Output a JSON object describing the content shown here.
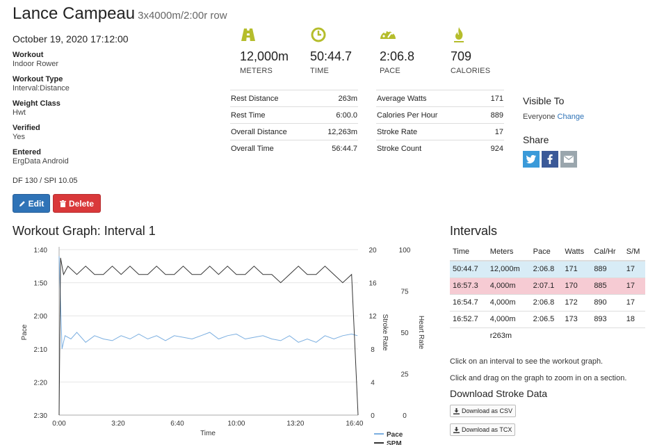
{
  "header": {
    "name": "Lance Campeau",
    "subtitle": "3x4000m/2:00r row",
    "date": "October 19, 2020 17:12:00"
  },
  "info": [
    {
      "label": "Workout",
      "value": "Indoor Rower"
    },
    {
      "label": "Workout Type",
      "value": "Interval:Distance"
    },
    {
      "label": "Weight Class",
      "value": "Hwt"
    },
    {
      "label": "Verified",
      "value": "Yes"
    },
    {
      "label": "Entered",
      "value": "ErgData Android"
    }
  ],
  "df_spi": "DF 130 / SPI 10.05",
  "buttons": {
    "edit": "Edit",
    "delete": "Delete"
  },
  "stats": [
    {
      "value": "12,000m",
      "unit": "METERS",
      "icon": "road-icon"
    },
    {
      "value": "50:44.7",
      "unit": "TIME",
      "icon": "clock-icon"
    },
    {
      "value": "2:06.8",
      "unit": "PACE",
      "icon": "dashboard-icon"
    },
    {
      "value": "709",
      "unit": "CALORIES",
      "icon": "flame-icon"
    }
  ],
  "stat_icon_color": "#b5bd2c",
  "details_left": [
    {
      "label": "Rest Distance",
      "value": "263m"
    },
    {
      "label": "Rest Time",
      "value": "6:00.0"
    },
    {
      "label": "Overall Distance",
      "value": "12,263m"
    },
    {
      "label": "Overall Time",
      "value": "56:44.7"
    }
  ],
  "details_right": [
    {
      "label": "Average Watts",
      "value": "171"
    },
    {
      "label": "Calories Per Hour",
      "value": "889"
    },
    {
      "label": "Stroke Rate",
      "value": "17"
    },
    {
      "label": "Stroke Count",
      "value": "924"
    }
  ],
  "visible": {
    "heading": "Visible To",
    "value": "Everyone",
    "change": "Change"
  },
  "share": {
    "heading": "Share",
    "buttons": [
      "twitter-icon",
      "facebook-icon",
      "email-icon"
    ]
  },
  "graph": {
    "heading": "Workout Graph: Interval 1"
  },
  "chart_data": {
    "type": "line",
    "title": "Workout Graph: Interval 1",
    "xlabel": "Time",
    "ylabel_left": "Pace",
    "ylabel_right1": "Stroke Rate",
    "ylabel_right2": "Heart Rate",
    "x_ticks": [
      "0:00",
      "3:20",
      "6:40",
      "10:00",
      "13:20",
      "16:40"
    ],
    "xlim_seconds": [
      0,
      1012
    ],
    "y_left_ticks": [
      "1:40",
      "1:50",
      "2:00",
      "2:10",
      "2:20",
      "2:30"
    ],
    "y_left_range_seconds": [
      100,
      150
    ],
    "y_right1_ticks": [
      "20",
      "16",
      "12",
      "8",
      "4",
      "0"
    ],
    "y_right1_range": [
      0,
      20
    ],
    "y_right2_ticks": [
      "100",
      "75",
      "50",
      "25",
      "0"
    ],
    "y_right2_range": [
      0,
      100
    ],
    "legend": [
      "Pace",
      "SPM"
    ],
    "legend_position": "bottom-right",
    "grid": "horizontal",
    "series": [
      {
        "name": "Pace",
        "axis": "left",
        "color": "#7aaee0",
        "x": [
          0,
          10,
          20,
          40,
          60,
          90,
          120,
          150,
          180,
          210,
          240,
          270,
          300,
          330,
          360,
          390,
          420,
          450,
          480,
          510,
          540,
          570,
          600,
          630,
          660,
          690,
          720,
          750,
          780,
          810,
          840,
          870,
          900,
          930,
          960,
          990,
          1010
        ],
        "y": [
          102,
          130,
          126,
          127,
          125,
          128,
          126,
          127,
          127.5,
          126,
          127,
          125.5,
          127,
          126,
          127.5,
          126,
          126.5,
          127,
          126,
          125,
          127,
          126,
          125.5,
          127,
          126.5,
          126,
          127,
          127.5,
          126,
          128,
          127,
          128,
          126,
          127,
          126,
          125.5,
          126
        ]
      },
      {
        "name": "SPM",
        "axis": "right1",
        "color": "#333333",
        "x": [
          0,
          5,
          15,
          30,
          60,
          90,
          120,
          150,
          180,
          210,
          240,
          270,
          300,
          330,
          360,
          390,
          420,
          450,
          480,
          510,
          540,
          570,
          600,
          630,
          660,
          690,
          720,
          750,
          780,
          810,
          840,
          870,
          900,
          930,
          960,
          990,
          1012
        ],
        "y": [
          0,
          19,
          17,
          18,
          17,
          18,
          17,
          17,
          18,
          17,
          18,
          17,
          17,
          18,
          17,
          17,
          18,
          17,
          17,
          18,
          17,
          18,
          17,
          17,
          18,
          17,
          17,
          16,
          17,
          18,
          17,
          17,
          18,
          17,
          16,
          17,
          0
        ]
      }
    ]
  },
  "intervals": {
    "heading": "Intervals",
    "columns": [
      "Time",
      "Meters",
      "Pace",
      "Watts",
      "Cal/Hr",
      "S/M"
    ],
    "rows": [
      [
        "50:44.7",
        "12,000m",
        "2:06.8",
        "171",
        "889",
        "17"
      ],
      [
        "16:57.3",
        "4,000m",
        "2:07.1",
        "170",
        "885",
        "17"
      ],
      [
        "16:54.7",
        "4,000m",
        "2:06.8",
        "172",
        "890",
        "17"
      ],
      [
        "16:52.7",
        "4,000m",
        "2:06.5",
        "173",
        "893",
        "18"
      ]
    ],
    "rest_row": "r263m",
    "row_colors": [
      "#d8ecf6",
      "#f6cbd3"
    ]
  },
  "notes": {
    "click_interval": "Click on an interval to see the workout graph.",
    "click_drag": "Click and drag on the graph to zoom in on a section."
  },
  "download": {
    "heading": "Download Stroke Data",
    "csv": "Download as CSV",
    "tcx": "Download as TCX"
  }
}
